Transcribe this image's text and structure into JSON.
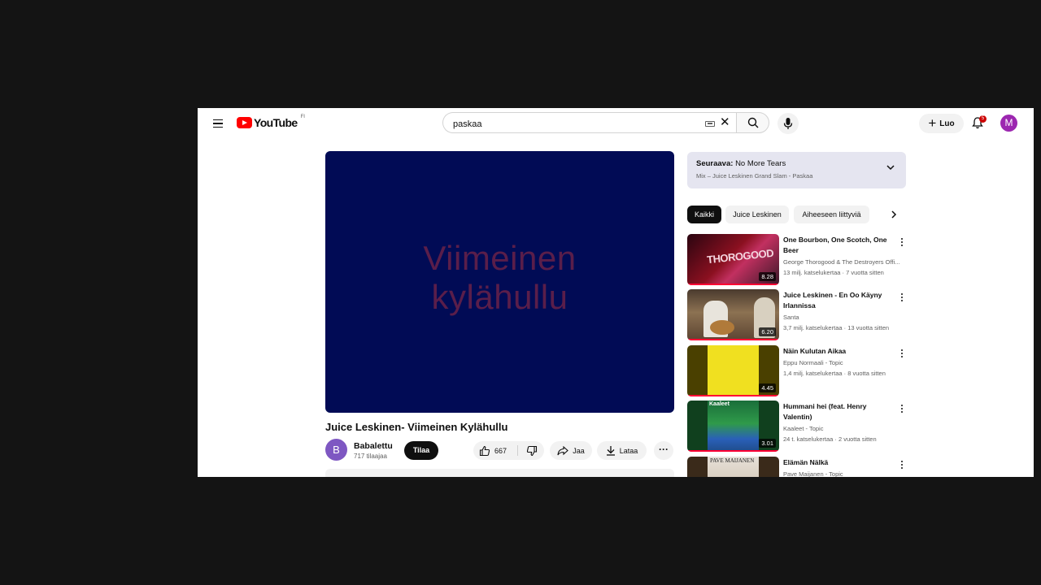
{
  "header": {
    "logo_text": "YouTube",
    "logo_country": "FI",
    "search_value": "paskaa",
    "create_label": "Luo",
    "notif_count": "5",
    "avatar_letter": "M"
  },
  "player": {
    "lyric_line1": "Viimeinen",
    "lyric_line2": "kylähullu"
  },
  "video": {
    "title": "Juice Leskinen- Viimeinen Kylähullu",
    "channel_letter": "B",
    "channel_name": "Babalettu",
    "subscribers": "717 tilaajaa",
    "subscribe_label": "Tilaa",
    "likes": "667",
    "share_label": "Jaa",
    "download_label": "Lataa"
  },
  "upnext": {
    "prefix": "Seuraava:",
    "title": "No More Tears",
    "subtitle": "Mix – Juice Leskinen Grand Slam - Paskaa"
  },
  "chips": [
    "Kaikki",
    "Juice Leskinen",
    "Aiheeseen liittyviä"
  ],
  "recommendations": [
    {
      "title": "One Bourbon, One Scotch, One Beer",
      "channel": "George Thorogood & The Destroyers Offi...",
      "stats": "13 milj. katselukertaa · 7 vuotta sitten",
      "duration": "8.28",
      "thumb_text": "THOROGOOD"
    },
    {
      "title": "Juice Leskinen - En Oo Käyny Irlannissa",
      "channel": "Santa",
      "stats": "3,7 milj. katselukertaa · 13 vuotta sitten",
      "duration": "6.20"
    },
    {
      "title": "Näin Kulutan Aikaa",
      "channel": "Eppu Normaali - Topic",
      "stats": "1,4 milj. katselukertaa · 8 vuotta sitten",
      "duration": "4.45"
    },
    {
      "title": "Hummani hei (feat. Henry Valentin)",
      "channel": "Kaaleet - Topic",
      "stats": "24 t. katselukertaa · 2 vuotta sitten",
      "duration": "3.01",
      "thumb_text": "Kaaleet"
    },
    {
      "title": "Elämän Nälkä",
      "channel": "Pave Maijanen - Topic",
      "stats": "",
      "duration": "",
      "thumb_text": "PAVE MAIJANEN"
    }
  ],
  "colors": {
    "brand_red": "#ff0000",
    "player_bg": "#010b55",
    "lyric": "#5a1e4a"
  }
}
